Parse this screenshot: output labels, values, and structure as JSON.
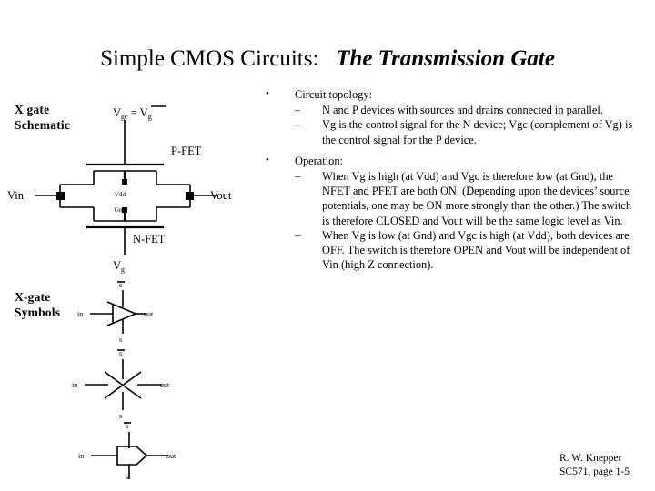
{
  "title": {
    "plain": "Simple CMOS Circuits:",
    "italic": "The Transmission Gate"
  },
  "captions": {
    "schematic_line1": "X gate",
    "schematic_line2": "Schematic",
    "symbols_line1": "X-gate",
    "symbols_line2": "Symbols"
  },
  "schematic": {
    "gate_top_label_prefix": "V",
    "gate_top_label": "Vgc = Vg",
    "gate_top_base": "V",
    "gate_top_sub": "gc",
    "gate_top_eq": " = ",
    "gate_top_bar_base": "V",
    "gate_top_bar_sub": "g",
    "pfet_label": "P-FET",
    "nfet_label": "N-FET",
    "vin_label": "Vin",
    "vout_label": "Vout",
    "vdd_label": "Vdd",
    "gnd_label": "Gnd",
    "gate_bottom_base": "V",
    "gate_bottom_sub": "g"
  },
  "symbols": {
    "triangle": {
      "in": "in",
      "out": "out",
      "top_ctrl": "s",
      "bottom_ctrl": "s"
    },
    "cross": {
      "in": "in",
      "out": "out",
      "top_ctrl": "s",
      "bottom_ctrl": "s"
    },
    "pentagon": {
      "in": "in",
      "out": "out",
      "top_ctrl": "s",
      "bottom_ctrl": "s"
    }
  },
  "content": {
    "topology_heading": "Circuit topology:",
    "topology_items": [
      "N and P devices with sources and drains connected in parallel.",
      "Vg is the control signal for the N device;  Vgc (complement of Vg) is the control signal for the P device."
    ],
    "operation_heading": "Operation:",
    "operation_items": [
      "When Vg is high (at Vdd) and Vgc is therefore low (at Gnd), the NFET and PFET are both ON.  (Depending upon the devices’ source potentials, one may be ON more strongly than the other.)  The switch is therefore CLOSED and Vout will be the same logic level as Vin.",
      "When Vg is low (at Gnd) and Vgc is high (at Vdd), both devices are OFF.  The switch is therefore OPEN and Vout will be independent of Vin (high Z connection)."
    ],
    "bullet_mark": "•",
    "dash_mark": "–"
  },
  "footer": {
    "author": "R. W. Knepper",
    "course": "SC571,  page 1-5"
  },
  "colors": {
    "background": "#ffffff",
    "ink": "#000000"
  }
}
